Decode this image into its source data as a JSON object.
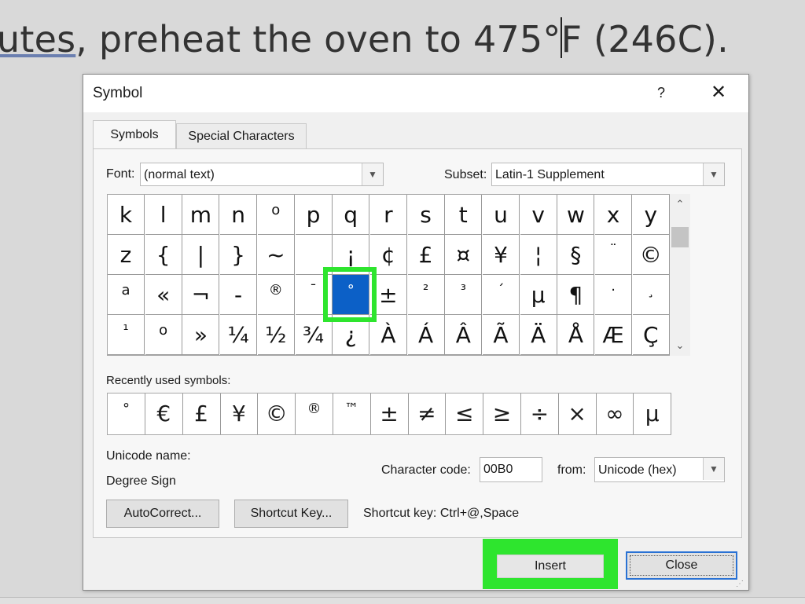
{
  "document": {
    "text_underlined": "utes",
    "text_before_caret": ", preheat the oven to 475°",
    "text_after_caret": "F (246C)."
  },
  "dialog": {
    "title": "Symbol",
    "help": "?",
    "close_glyph": "✕",
    "tabs": [
      "Symbols",
      "Special Characters"
    ],
    "font_label": "Font:",
    "font_value": "(normal text)",
    "subset_label": "Subset:",
    "subset_value": "Latin-1 Supplement",
    "grid": [
      [
        "k",
        "l",
        "m",
        "n",
        "o",
        "p",
        "q",
        "r",
        "s",
        "t",
        "u",
        "v",
        "w",
        "x",
        "y"
      ],
      [
        "z",
        "{",
        "|",
        "}",
        "~",
        "",
        "¡",
        "¢",
        "£",
        "¤",
        "¥",
        "¦",
        "§",
        "¨",
        "©"
      ],
      [
        "a",
        "«",
        "¬",
        "-",
        "®",
        "¯",
        "°",
        "±",
        "²",
        "³",
        "´",
        "µ",
        "¶",
        "·",
        "¸"
      ],
      [
        "¹",
        "o",
        "»",
        "¼",
        "½",
        "¾",
        "¿",
        "À",
        "Á",
        "Â",
        "Ã",
        "Ä",
        "Å",
        "Æ",
        "Ç"
      ]
    ],
    "selected_symbol": "°",
    "recent_label": "Recently used symbols:",
    "recent": [
      "°",
      "€",
      "£",
      "¥",
      "©",
      "®",
      "™",
      "±",
      "≠",
      "≤",
      "≥",
      "÷",
      "×",
      "∞",
      "µ"
    ],
    "unicode_name_label": "Unicode name:",
    "unicode_name_value": "Degree Sign",
    "char_code_label": "Character code:",
    "char_code_value": "00B0",
    "from_label": "from:",
    "from_value": "Unicode (hex)",
    "autocorrect_label": "AutoCorrect...",
    "shortcut_key_btn_label": "Shortcut Key...",
    "shortcut_key_text": "Shortcut key: Ctrl+@,Space",
    "insert_label": "Insert",
    "close_label": "Close"
  }
}
